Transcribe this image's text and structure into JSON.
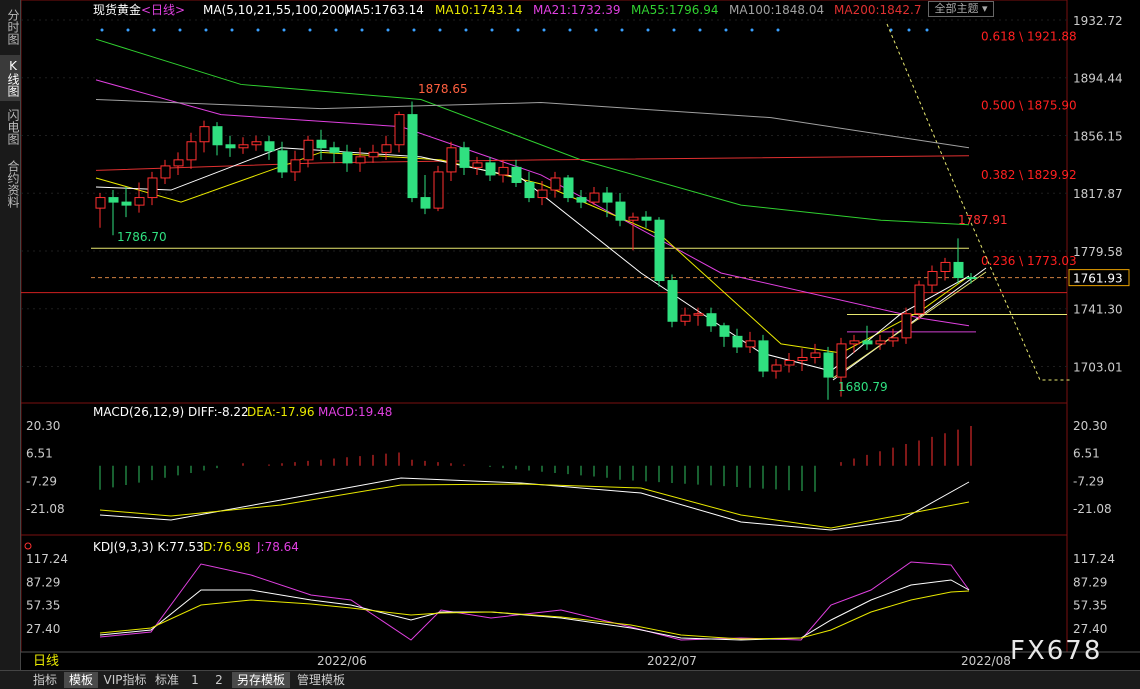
{
  "sidebar": {
    "tabs": [
      "分时图",
      "K线图",
      "闪电图",
      "合约资料"
    ],
    "active": 1
  },
  "header": {
    "instrument": "现货黄金",
    "period_link": "<日线>",
    "ma_params": "MA(5,10,21,55,100,200)",
    "ma_values": [
      {
        "label": "MA5:1763.14",
        "color": "#ffffff"
      },
      {
        "label": "MA10:1743.14",
        "color": "#e8e800"
      },
      {
        "label": "MA21:1732.39",
        "color": "#e040e0"
      },
      {
        "label": "MA55:1796.94",
        "color": "#30d030"
      },
      {
        "label": "MA100:1848.04",
        "color": "#a0a0a0"
      },
      {
        "label": "MA200:1842.7",
        "color": "#e03030"
      }
    ],
    "theme_button": "全部主题",
    "theme_icon": "chevron-down-icon"
  },
  "price_axis": {
    "ticks": [
      "1932.72",
      "1894.44",
      "1856.15",
      "1817.87",
      "1779.58",
      "1741.30",
      "1703.01"
    ],
    "last_price": "1761.93"
  },
  "fib_labels": [
    {
      "text": "0.618 \\ 1921.88"
    },
    {
      "text": "0.500 \\ 1875.90"
    },
    {
      "text": "0.382 \\ 1829.92"
    },
    {
      "text": "0.236 \\ 1773.03"
    }
  ],
  "annotations": {
    "high_main": "1878.65",
    "low_left": "1786.70",
    "low_main": "1680.79",
    "high_right": "1787.91"
  },
  "macd": {
    "params": "MACD(26,12,9)",
    "diff": "DIFF:-8.22",
    "dea": "DEA:-17.96",
    "macd": "MACD:19.48",
    "ticks": [
      "20.30",
      "6.51",
      "-7.29",
      "-21.08"
    ]
  },
  "kdj": {
    "params": "KDJ(9,3,3)",
    "k": "K:77.53",
    "d": "D:76.98",
    "j": "J:78.64",
    "ticks": [
      "117.24",
      "87.29",
      "57.35",
      "27.40"
    ]
  },
  "x_axis": {
    "labels": [
      "2022/06",
      "2022/07",
      "2022/08"
    ],
    "period": "日线"
  },
  "bottom_tabs": [
    "指标",
    "模板",
    "VIP指标",
    "标准",
    "1",
    "2",
    "另存模板",
    "管理模板"
  ],
  "watermark": "FX678",
  "chart_data": {
    "type": "candlestick",
    "title": "现货黄金 日线",
    "ylim": [
      1680,
      1940
    ],
    "candles": [
      [
        1808,
        1815,
        1795,
        1818
      ],
      [
        1815,
        1812,
        1790,
        1820
      ],
      [
        1812,
        1810,
        1802,
        1822
      ],
      [
        1810,
        1815,
        1805,
        1825
      ],
      [
        1815,
        1828,
        1810,
        1832
      ],
      [
        1828,
        1836,
        1824,
        1840
      ],
      [
        1836,
        1840,
        1830,
        1845
      ],
      [
        1840,
        1852,
        1834,
        1858
      ],
      [
        1852,
        1862,
        1845,
        1866
      ],
      [
        1862,
        1850,
        1843,
        1865
      ],
      [
        1850,
        1848,
        1842,
        1856
      ],
      [
        1848,
        1850,
        1844,
        1855
      ],
      [
        1850,
        1852,
        1846,
        1856
      ],
      [
        1852,
        1846,
        1840,
        1856
      ],
      [
        1846,
        1832,
        1828,
        1852
      ],
      [
        1832,
        1840,
        1826,
        1846
      ],
      [
        1840,
        1853,
        1835,
        1856
      ],
      [
        1853,
        1848,
        1840,
        1860
      ],
      [
        1848,
        1845,
        1838,
        1852
      ],
      [
        1845,
        1838,
        1832,
        1850
      ],
      [
        1838,
        1842,
        1832,
        1848
      ],
      [
        1842,
        1845,
        1838,
        1850
      ],
      [
        1845,
        1850,
        1840,
        1856
      ],
      [
        1850,
        1870,
        1845,
        1872
      ],
      [
        1870,
        1815,
        1812,
        1878.65
      ],
      [
        1815,
        1808,
        1804,
        1830
      ],
      [
        1808,
        1832,
        1806,
        1836
      ],
      [
        1832,
        1848,
        1826,
        1852
      ],
      [
        1848,
        1835,
        1830,
        1852
      ],
      [
        1835,
        1838,
        1830,
        1842
      ],
      [
        1838,
        1830,
        1826,
        1842
      ],
      [
        1830,
        1835,
        1825,
        1840
      ],
      [
        1835,
        1825,
        1822,
        1840
      ],
      [
        1825,
        1815,
        1812,
        1832
      ],
      [
        1815,
        1820,
        1810,
        1826
      ],
      [
        1820,
        1828,
        1815,
        1832
      ],
      [
        1828,
        1815,
        1812,
        1830
      ],
      [
        1815,
        1812,
        1808,
        1820
      ],
      [
        1812,
        1818,
        1810,
        1822
      ],
      [
        1818,
        1812,
        1802,
        1822
      ],
      [
        1812,
        1800,
        1796,
        1818
      ],
      [
        1800,
        1802,
        1780,
        1805
      ],
      [
        1802,
        1800,
        1795,
        1806
      ],
      [
        1800,
        1760,
        1756,
        1802
      ],
      [
        1760,
        1733,
        1729,
        1764
      ],
      [
        1733,
        1737,
        1730,
        1742
      ],
      [
        1737,
        1738,
        1730,
        1742
      ],
      [
        1738,
        1730,
        1726,
        1742
      ],
      [
        1730,
        1723,
        1716,
        1732
      ],
      [
        1723,
        1716,
        1712,
        1728
      ],
      [
        1716,
        1720,
        1712,
        1726
      ],
      [
        1720,
        1700,
        1696,
        1724
      ],
      [
        1700,
        1704,
        1695,
        1708
      ],
      [
        1704,
        1707,
        1699,
        1712
      ],
      [
        1707,
        1709,
        1700,
        1715
      ],
      [
        1709,
        1712,
        1705,
        1718
      ],
      [
        1712,
        1696,
        1681,
        1716
      ],
      [
        1696,
        1718,
        1683,
        1722
      ],
      [
        1718,
        1720,
        1712,
        1724
      ],
      [
        1720,
        1718,
        1714,
        1730
      ],
      [
        1718,
        1720,
        1714,
        1724
      ],
      [
        1720,
        1722,
        1716,
        1728
      ],
      [
        1722,
        1738,
        1718,
        1742
      ],
      [
        1738,
        1757,
        1734,
        1760
      ],
      [
        1757,
        1766,
        1752,
        1770
      ],
      [
        1766,
        1772,
        1760,
        1775
      ],
      [
        1772,
        1762,
        1758,
        1787.91
      ],
      [
        1762,
        1761.93,
        1758,
        1765
      ]
    ]
  }
}
